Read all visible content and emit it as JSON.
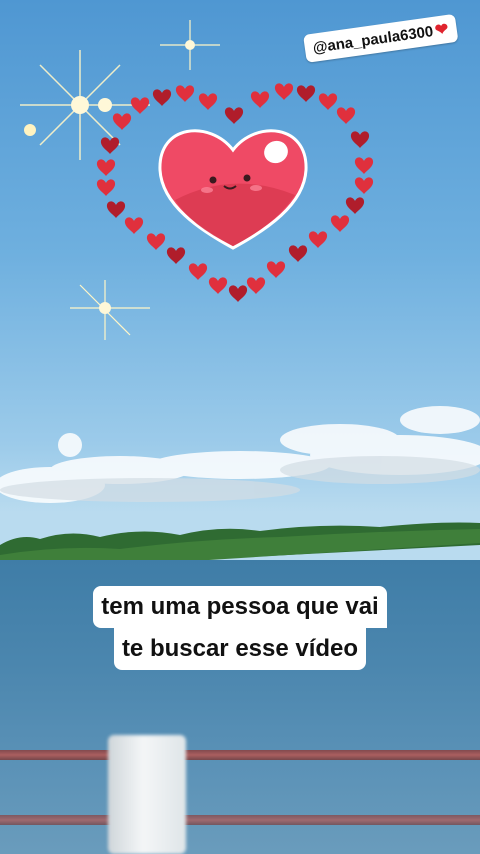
{
  "overlay": {
    "handle": "@ana_paula6300",
    "handle_emoji": "❤"
  },
  "caption": {
    "line1": "tem uma pessoa que vai",
    "line2": "te buscar esse vídeo"
  },
  "colors": {
    "sky_top": "#4f97d2",
    "water": "#4b86ae",
    "heart_main": "#ef4a65",
    "heart_ring": "#c8283c",
    "railing": "#b85650"
  }
}
